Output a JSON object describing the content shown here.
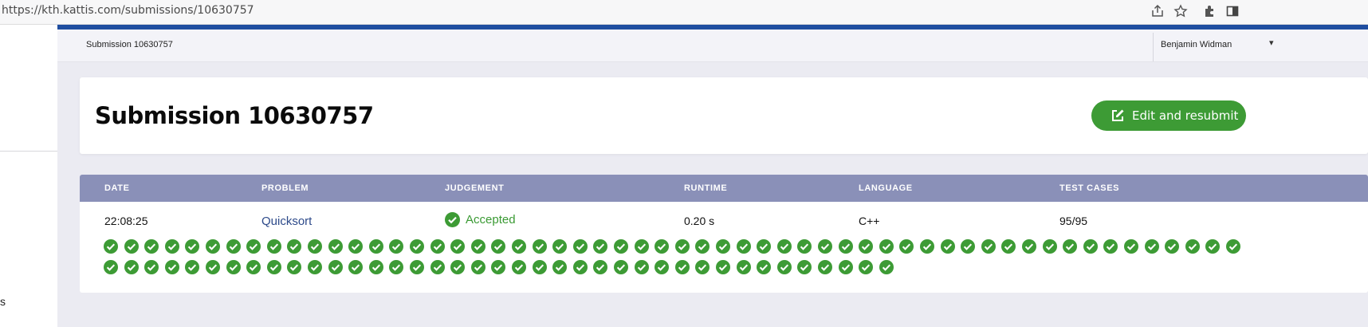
{
  "browser": {
    "url": "https://kth.kattis.com/submissions/10630757",
    "icons": [
      "share-icon",
      "star-icon",
      "extensions-icon",
      "sidepanel-icon"
    ]
  },
  "sidebar": {
    "partial_text": "s"
  },
  "subnav": {
    "breadcrumb": "Submission 10630757",
    "user_name": "Benjamin Widman"
  },
  "page": {
    "title": "Submission 10630757",
    "resubmit_label": "Edit and resubmit"
  },
  "table": {
    "headers": [
      "DATE",
      "PROBLEM",
      "JUDGEMENT",
      "RUNTIME",
      "LANGUAGE",
      "TEST CASES"
    ],
    "row": {
      "date": "22:08:25",
      "problem": "Quicksort",
      "judgement": "Accepted",
      "runtime": "0.20 s",
      "language": "C++",
      "test_cases": "95/95"
    },
    "test_case_results": {
      "total": 95,
      "passed": 95,
      "status": "accepted"
    }
  },
  "colors": {
    "accent_blue": "#1f4ea0",
    "header_bg": "#8a90b8",
    "success_green": "#3d9b35",
    "link": "#2d4a8a"
  }
}
